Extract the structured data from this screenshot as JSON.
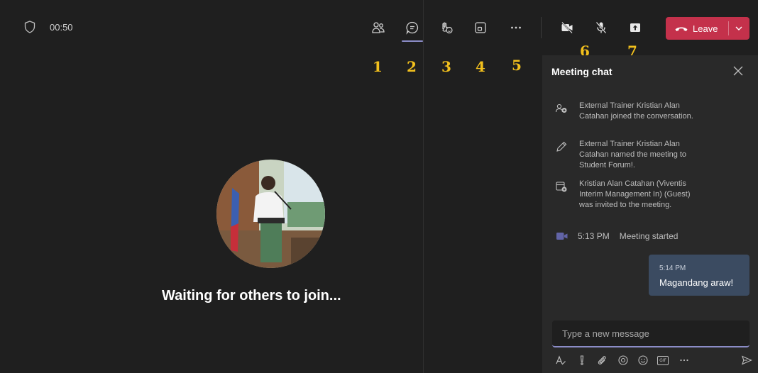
{
  "topbar": {
    "timer": "00:50",
    "leave_label": "Leave"
  },
  "annotations": [
    "1",
    "2",
    "3",
    "4",
    "5",
    "6",
    "7"
  ],
  "stage": {
    "waiting_text": "Waiting for others to join..."
  },
  "chat": {
    "title": "Meeting chat",
    "events": [
      {
        "icon": "people-join-icon",
        "text": "External Trainer Kristian Alan Catahan joined the conversation."
      },
      {
        "icon": "pencil-icon",
        "text": "External Trainer Kristian Alan Catahan named the meeting to Student Forum!."
      },
      {
        "icon": "calendar-invite-icon",
        "text": "Kristian Alan Catahan (Viventis Interim Management In) (Guest) was invited to the meeting."
      }
    ],
    "started": {
      "icon": "video-camera-icon",
      "time": "5:13 PM",
      "text": "Meeting started"
    },
    "message": {
      "time": "5:14 PM",
      "text": "Magandang araw!"
    },
    "compose_placeholder": "Type a new message"
  },
  "colors": {
    "background": "#1f1f1f",
    "panel": "#292929",
    "leave": "#c4314b",
    "accent": "#8b8cc7",
    "bubble": "#3b4b61",
    "annotation": "#f2c01d"
  }
}
